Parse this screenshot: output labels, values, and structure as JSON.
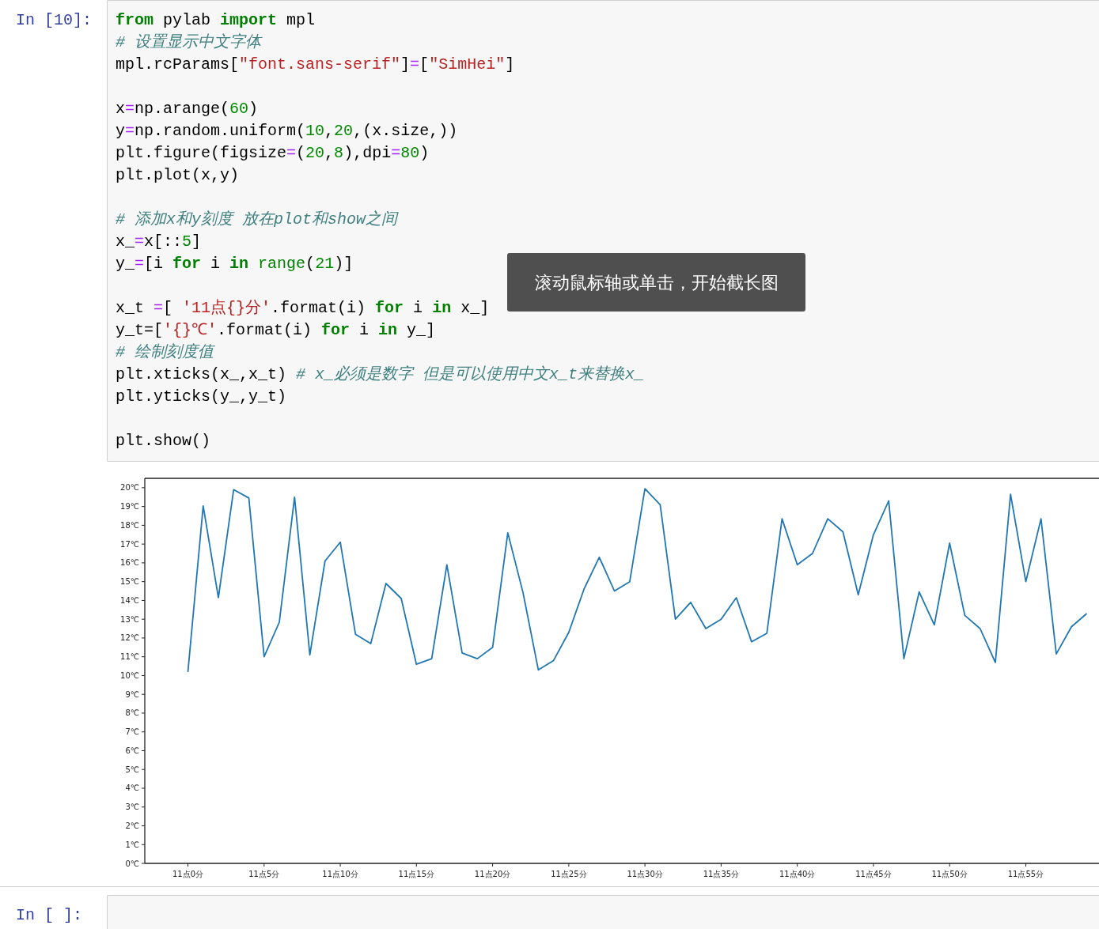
{
  "cells": [
    {
      "prompt": "In [10]:",
      "code_blocks": [
        [
          [
            {
              "kind": "keyword",
              "text": "from"
            },
            {
              "kind": "plain",
              "text": " pylab "
            },
            {
              "kind": "keyword",
              "text": "import"
            },
            {
              "kind": "plain",
              "text": " mpl"
            }
          ],
          [
            {
              "kind": "comment",
              "text": "# 设置显示中文字体"
            }
          ],
          [
            {
              "kind": "plain",
              "text": "mpl.rcParams["
            },
            {
              "kind": "string",
              "text": "\"font.sans-serif\""
            },
            {
              "kind": "plain",
              "text": "]"
            },
            {
              "kind": "operator",
              "text": "="
            },
            {
              "kind": "plain",
              "text": "["
            },
            {
              "kind": "string",
              "text": "\"SimHei\""
            },
            {
              "kind": "plain",
              "text": "]"
            }
          ]
        ],
        [
          [
            {
              "kind": "plain",
              "text": "x"
            },
            {
              "kind": "operator",
              "text": "="
            },
            {
              "kind": "plain",
              "text": "np.arange("
            },
            {
              "kind": "number",
              "text": "60"
            },
            {
              "kind": "plain",
              "text": ")"
            }
          ],
          [
            {
              "kind": "plain",
              "text": "y"
            },
            {
              "kind": "operator",
              "text": "="
            },
            {
              "kind": "plain",
              "text": "np.random.uniform("
            },
            {
              "kind": "number",
              "text": "10"
            },
            {
              "kind": "plain",
              "text": ","
            },
            {
              "kind": "number",
              "text": "20"
            },
            {
              "kind": "plain",
              "text": ",(x.size,))"
            }
          ],
          [
            {
              "kind": "plain",
              "text": "plt.figure(figsize"
            },
            {
              "kind": "operator",
              "text": "="
            },
            {
              "kind": "plain",
              "text": "("
            },
            {
              "kind": "number",
              "text": "20"
            },
            {
              "kind": "plain",
              "text": ","
            },
            {
              "kind": "number",
              "text": "8"
            },
            {
              "kind": "plain",
              "text": "),dpi"
            },
            {
              "kind": "operator",
              "text": "="
            },
            {
              "kind": "number",
              "text": "80"
            },
            {
              "kind": "plain",
              "text": ")"
            }
          ],
          [
            {
              "kind": "plain",
              "text": "plt.plot(x,y)"
            }
          ]
        ],
        [
          [
            {
              "kind": "comment",
              "text": "# 添加x和y刻度 放在plot和show之间"
            }
          ],
          [
            {
              "kind": "plain",
              "text": "x_"
            },
            {
              "kind": "operator",
              "text": "="
            },
            {
              "kind": "plain",
              "text": "x[::"
            },
            {
              "kind": "number",
              "text": "5"
            },
            {
              "kind": "plain",
              "text": "]"
            }
          ],
          [
            {
              "kind": "plain",
              "text": "y_"
            },
            {
              "kind": "operator",
              "text": "="
            },
            {
              "kind": "plain",
              "text": "[i "
            },
            {
              "kind": "keyword",
              "text": "for"
            },
            {
              "kind": "plain",
              "text": " i "
            },
            {
              "kind": "keyword",
              "text": "in"
            },
            {
              "kind": "builtin",
              "text": " range"
            },
            {
              "kind": "plain",
              "text": "("
            },
            {
              "kind": "number",
              "text": "21"
            },
            {
              "kind": "plain",
              "text": ")]"
            }
          ]
        ],
        [
          [
            {
              "kind": "plain",
              "text": "x_t "
            },
            {
              "kind": "operator",
              "text": "="
            },
            {
              "kind": "plain",
              "text": "[ "
            },
            {
              "kind": "string",
              "text": "'11点{}分'"
            },
            {
              "kind": "plain",
              "text": ".format(i) "
            },
            {
              "kind": "keyword",
              "text": "for"
            },
            {
              "kind": "plain",
              "text": " i "
            },
            {
              "kind": "keyword",
              "text": "in"
            },
            {
              "kind": "plain",
              "text": " x_]"
            }
          ],
          [
            {
              "kind": "plain",
              "text": "y_t=["
            },
            {
              "kind": "string",
              "text": "'{}℃'"
            },
            {
              "kind": "plain",
              "text": ".format(i) "
            },
            {
              "kind": "keyword",
              "text": "for"
            },
            {
              "kind": "plain",
              "text": " i "
            },
            {
              "kind": "keyword",
              "text": "in"
            },
            {
              "kind": "plain",
              "text": " y_]"
            }
          ],
          [
            {
              "kind": "comment",
              "text": "# 绘制刻度值"
            }
          ],
          [
            {
              "kind": "plain",
              "text": "plt.xticks(x_,x_t) "
            },
            {
              "kind": "comment",
              "text": "# x_必须是数字 但是可以使用中文x_t来替换x_"
            }
          ],
          [
            {
              "kind": "plain",
              "text": "plt.yticks(y_,y_t)"
            }
          ]
        ],
        [
          [
            {
              "kind": "plain",
              "text": "plt.show()"
            }
          ]
        ]
      ],
      "tooltip": "滚动鼠标轴或单击，开始截长图",
      "output": {
        "chart_data": {
          "type": "line",
          "categories": [
            "11点0分",
            null,
            null,
            null,
            null,
            "11点5分",
            null,
            null,
            null,
            null,
            "11点10分",
            null,
            null,
            null,
            null,
            "11点15分",
            null,
            null,
            null,
            null,
            "11点20分",
            null,
            null,
            null,
            null,
            "11点25分",
            null,
            null,
            null,
            null,
            "11点30分",
            null,
            null,
            null,
            null,
            "11点35分",
            null,
            null,
            null,
            null,
            "11点40分",
            null,
            null,
            null,
            null,
            "11点45分",
            null,
            null,
            null,
            null,
            "11点50分",
            null,
            null,
            null,
            null,
            "11点55分",
            null,
            null,
            null,
            null
          ],
          "series": [
            {
              "color": "#1f77b4",
              "values": [
                10.19,
                19.03,
                14.15,
                19.9,
                19.45,
                11.0,
                12.84,
                19.5,
                11.1,
                16.1,
                17.1,
                12.2,
                11.7,
                14.9,
                14.1,
                10.6,
                10.9,
                15.9,
                11.2,
                10.9,
                11.5,
                17.6,
                14.4,
                10.3,
                10.8,
                12.3,
                14.6,
                16.3,
                14.5,
                15.0,
                19.95,
                19.1,
                13.0,
                13.9,
                12.5,
                13.0,
                14.15,
                11.8,
                12.25,
                18.35,
                15.9,
                16.5,
                18.35,
                17.65,
                14.3,
                17.5,
                19.3,
                10.9,
                14.45,
                12.7,
                17.05,
                13.2,
                12.5,
                10.7,
                19.65,
                15.0,
                18.35,
                11.15,
                12.6,
                13.3
              ]
            }
          ],
          "ylim": [
            0,
            20.5
          ],
          "yticks": [
            {
              "value": 0,
              "label": "0℃"
            },
            {
              "value": 1,
              "label": "1℃"
            },
            {
              "value": 2,
              "label": "2℃"
            },
            {
              "value": 3,
              "label": "3℃"
            },
            {
              "value": 4,
              "label": "4℃"
            },
            {
              "value": 5,
              "label": "5℃"
            },
            {
              "value": 6,
              "label": "6℃"
            },
            {
              "value": 7,
              "label": "7℃"
            },
            {
              "value": 8,
              "label": "8℃"
            },
            {
              "value": 9,
              "label": "9℃"
            },
            {
              "value": 10,
              "label": "10℃"
            },
            {
              "value": 11,
              "label": "11℃"
            },
            {
              "value": 12,
              "label": "12℃"
            },
            {
              "value": 13,
              "label": "13℃"
            },
            {
              "value": 14,
              "label": "14℃"
            },
            {
              "value": 15,
              "label": "15℃"
            },
            {
              "value": 16,
              "label": "16℃"
            },
            {
              "value": 17,
              "label": "17℃"
            },
            {
              "value": 18,
              "label": "18℃"
            },
            {
              "value": 19,
              "label": "19℃"
            },
            {
              "value": 20,
              "label": "20℃"
            }
          ]
        }
      }
    },
    {
      "prompt": "In [ ]:"
    }
  ]
}
